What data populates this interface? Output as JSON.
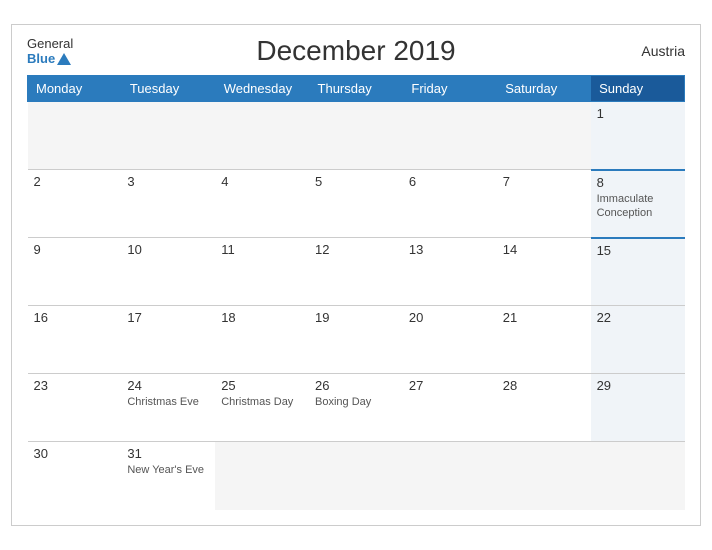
{
  "header": {
    "logo_general": "General",
    "logo_blue": "Blue",
    "title": "December 2019",
    "country": "Austria"
  },
  "weekdays": [
    "Monday",
    "Tuesday",
    "Wednesday",
    "Thursday",
    "Friday",
    "Saturday",
    "Sunday"
  ],
  "weeks": [
    [
      {
        "day": "",
        "holiday": "",
        "empty": true
      },
      {
        "day": "",
        "holiday": "",
        "empty": true
      },
      {
        "day": "",
        "holiday": "",
        "empty": true
      },
      {
        "day": "",
        "holiday": "",
        "empty": true
      },
      {
        "day": "",
        "holiday": "",
        "empty": true
      },
      {
        "day": "",
        "holiday": "",
        "empty": true
      },
      {
        "day": "1",
        "holiday": "",
        "empty": false,
        "sunday": true
      }
    ],
    [
      {
        "day": "2",
        "holiday": "",
        "empty": false
      },
      {
        "day": "3",
        "holiday": "",
        "empty": false
      },
      {
        "day": "4",
        "holiday": "",
        "empty": false
      },
      {
        "day": "5",
        "holiday": "",
        "empty": false
      },
      {
        "day": "6",
        "holiday": "",
        "empty": false
      },
      {
        "day": "7",
        "holiday": "",
        "empty": false
      },
      {
        "day": "8",
        "holiday": "Immaculate Conception",
        "empty": false,
        "sunday": true
      }
    ],
    [
      {
        "day": "9",
        "holiday": "",
        "empty": false
      },
      {
        "day": "10",
        "holiday": "",
        "empty": false
      },
      {
        "day": "11",
        "holiday": "",
        "empty": false
      },
      {
        "day": "12",
        "holiday": "",
        "empty": false
      },
      {
        "day": "13",
        "holiday": "",
        "empty": false
      },
      {
        "day": "14",
        "holiday": "",
        "empty": false
      },
      {
        "day": "15",
        "holiday": "",
        "empty": false,
        "sunday": true
      }
    ],
    [
      {
        "day": "16",
        "holiday": "",
        "empty": false
      },
      {
        "day": "17",
        "holiday": "",
        "empty": false
      },
      {
        "day": "18",
        "holiday": "",
        "empty": false
      },
      {
        "day": "19",
        "holiday": "",
        "empty": false
      },
      {
        "day": "20",
        "holiday": "",
        "empty": false
      },
      {
        "day": "21",
        "holiday": "",
        "empty": false
      },
      {
        "day": "22",
        "holiday": "",
        "empty": false,
        "sunday": true
      }
    ],
    [
      {
        "day": "23",
        "holiday": "",
        "empty": false
      },
      {
        "day": "24",
        "holiday": "Christmas Eve",
        "empty": false
      },
      {
        "day": "25",
        "holiday": "Christmas Day",
        "empty": false
      },
      {
        "day": "26",
        "holiday": "Boxing Day",
        "empty": false
      },
      {
        "day": "27",
        "holiday": "",
        "empty": false
      },
      {
        "day": "28",
        "holiday": "",
        "empty": false
      },
      {
        "day": "29",
        "holiday": "",
        "empty": false,
        "sunday": true
      }
    ],
    [
      {
        "day": "30",
        "holiday": "",
        "empty": false
      },
      {
        "day": "31",
        "holiday": "New Year's Eve",
        "empty": false
      },
      {
        "day": "",
        "holiday": "",
        "empty": true
      },
      {
        "day": "",
        "holiday": "",
        "empty": true
      },
      {
        "day": "",
        "holiday": "",
        "empty": true
      },
      {
        "day": "",
        "holiday": "",
        "empty": true
      },
      {
        "day": "",
        "holiday": "",
        "empty": true,
        "sunday": true
      }
    ]
  ]
}
